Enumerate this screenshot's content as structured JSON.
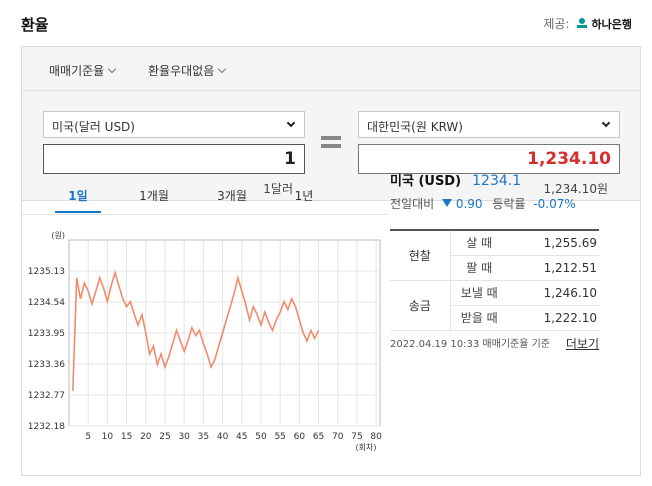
{
  "header": {
    "title": "환율",
    "provider_label": "제공:",
    "provider_name": "하나은행"
  },
  "filters": {
    "rate_type": "매매기준율",
    "preference": "환율우대없음"
  },
  "converter": {
    "from_currency": "미국(달러 USD)",
    "from_amount": "1",
    "from_caption": "1달러",
    "to_currency": "대한민국(원 KRW)",
    "to_amount": "1,234.10",
    "to_caption": "1,234.10원"
  },
  "tabs": [
    "1일",
    "1개월",
    "3개월",
    "1년"
  ],
  "summary": {
    "currency": "미국 (USD)",
    "rate": "1234.1",
    "prev_label": "전일대비",
    "prev_value": "0.90",
    "ratio_label": "등락률",
    "ratio_value": "-0.07%"
  },
  "rates": {
    "cash_group": "현찰",
    "remit_group": "송금",
    "rows": [
      {
        "label": "살 때",
        "value": "1,255.69"
      },
      {
        "label": "팔 때",
        "value": "1,212.51"
      },
      {
        "label": "보낼 때",
        "value": "1,246.10"
      },
      {
        "label": "받을 때",
        "value": "1,222.10"
      }
    ]
  },
  "footer": {
    "note": "2022.04.19 10:33  매매기준율 기준",
    "more": "더보기"
  },
  "colors": {
    "accent_blue": "#1a77c9",
    "amount_red": "#d32f2f",
    "line": "#f28a6b",
    "down_arrow": "#1a77c9"
  },
  "chart_data": {
    "type": "line",
    "unit_label": "(원)",
    "xlabel": "(회차)",
    "y_ticks": [
      "1235.13",
      "1234.54",
      "1233.95",
      "1233.36",
      "1232.77",
      "1232.18"
    ],
    "x_ticks": [
      "5",
      "10",
      "15",
      "20",
      "25",
      "30",
      "35",
      "40",
      "45",
      "50",
      "55",
      "60",
      "65",
      "70",
      "75",
      "80"
    ],
    "ylim": [
      1232.18,
      1235.72
    ],
    "xlim": [
      0,
      81
    ],
    "grid": true,
    "series": [
      {
        "values": [
          [
            1,
            1232.85
          ],
          [
            2,
            1235.0
          ],
          [
            3,
            1234.6
          ],
          [
            4,
            1234.9
          ],
          [
            5,
            1234.75
          ],
          [
            6,
            1234.5
          ],
          [
            7,
            1234.75
          ],
          [
            8,
            1235.0
          ],
          [
            9,
            1234.8
          ],
          [
            10,
            1234.55
          ],
          [
            11,
            1234.85
          ],
          [
            12,
            1235.1
          ],
          [
            13,
            1234.85
          ],
          [
            14,
            1234.6
          ],
          [
            15,
            1234.45
          ],
          [
            16,
            1234.55
          ],
          [
            17,
            1234.3
          ],
          [
            18,
            1234.1
          ],
          [
            19,
            1234.3
          ],
          [
            20,
            1233.95
          ],
          [
            21,
            1233.55
          ],
          [
            22,
            1233.7
          ],
          [
            23,
            1233.35
          ],
          [
            24,
            1233.55
          ],
          [
            25,
            1233.3
          ],
          [
            26,
            1233.5
          ],
          [
            27,
            1233.75
          ],
          [
            28,
            1234.0
          ],
          [
            29,
            1233.8
          ],
          [
            30,
            1233.6
          ],
          [
            31,
            1233.8
          ],
          [
            32,
            1234.05
          ],
          [
            33,
            1233.9
          ],
          [
            34,
            1234.0
          ],
          [
            35,
            1233.75
          ],
          [
            36,
            1233.55
          ],
          [
            37,
            1233.3
          ],
          [
            38,
            1233.45
          ],
          [
            39,
            1233.7
          ],
          [
            40,
            1233.95
          ],
          [
            41,
            1234.2
          ],
          [
            42,
            1234.45
          ],
          [
            43,
            1234.7
          ],
          [
            44,
            1235.0
          ],
          [
            45,
            1234.75
          ],
          [
            46,
            1234.5
          ],
          [
            47,
            1234.2
          ],
          [
            48,
            1234.45
          ],
          [
            49,
            1234.3
          ],
          [
            50,
            1234.1
          ],
          [
            51,
            1234.35
          ],
          [
            52,
            1234.15
          ],
          [
            53,
            1234.0
          ],
          [
            54,
            1234.2
          ],
          [
            55,
            1234.35
          ],
          [
            56,
            1234.55
          ],
          [
            57,
            1234.4
          ],
          [
            58,
            1234.6
          ],
          [
            59,
            1234.45
          ],
          [
            60,
            1234.2
          ],
          [
            61,
            1233.95
          ],
          [
            62,
            1233.8
          ],
          [
            63,
            1234.0
          ],
          [
            64,
            1233.85
          ],
          [
            65,
            1234.0
          ]
        ]
      }
    ]
  }
}
